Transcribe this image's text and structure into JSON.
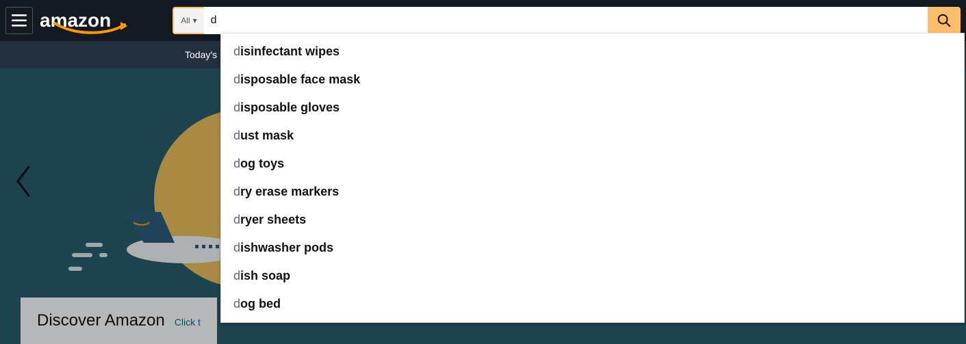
{
  "header": {
    "logo_text": "amazon",
    "search": {
      "category": "All",
      "query": "d",
      "placeholder": ""
    }
  },
  "subnav": {
    "item0": "Today's"
  },
  "hero": {
    "card_title": "Discover Amazon",
    "card_link": "Click t"
  },
  "suggestions": [
    {
      "prefix": "d",
      "rest": "isinfectant wipes"
    },
    {
      "prefix": "d",
      "rest": "isposable face mask"
    },
    {
      "prefix": "d",
      "rest": "isposable gloves"
    },
    {
      "prefix": "d",
      "rest": "ust mask"
    },
    {
      "prefix": "d",
      "rest": "og toys"
    },
    {
      "prefix": "d",
      "rest": "ry erase markers"
    },
    {
      "prefix": "d",
      "rest": "ryer sheets"
    },
    {
      "prefix": "d",
      "rest": "ishwasher pods"
    },
    {
      "prefix": "d",
      "rest": "ish soap"
    },
    {
      "prefix": "d",
      "rest": "og bed"
    }
  ]
}
